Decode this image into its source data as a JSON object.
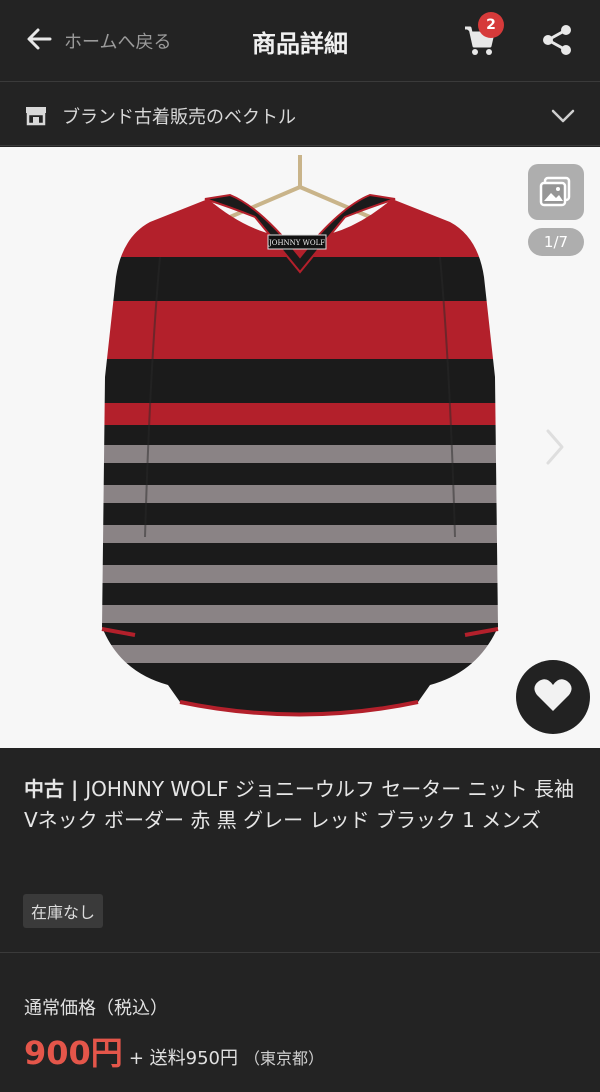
{
  "header": {
    "back_label": "ホームへ戻る",
    "title": "商品詳細",
    "cart_count": "2"
  },
  "shop": {
    "name": "ブランド古着販売のベクトル"
  },
  "gallery": {
    "counter": "1/7",
    "brand_tag": "JOHNNY WOLF"
  },
  "product": {
    "condition": "中古",
    "separator": " | ",
    "title": "JOHNNY WOLF ジョニーウルフ セーター ニット 長袖 Vネック ボーダー 赤 黒 グレー レッド ブラック 1 メンズ",
    "stock": "在庫なし"
  },
  "pricing": {
    "label": "通常価格（税込）",
    "price": "900円",
    "shipping": "+ 送料950円",
    "region": "（東京都）"
  },
  "colors": {
    "background": "#232323",
    "price": "#e4564a",
    "badge": "#d63a3a",
    "sweater_red": "#b3202b",
    "sweater_black": "#1b1b1b",
    "sweater_gray": "#8a8385"
  }
}
